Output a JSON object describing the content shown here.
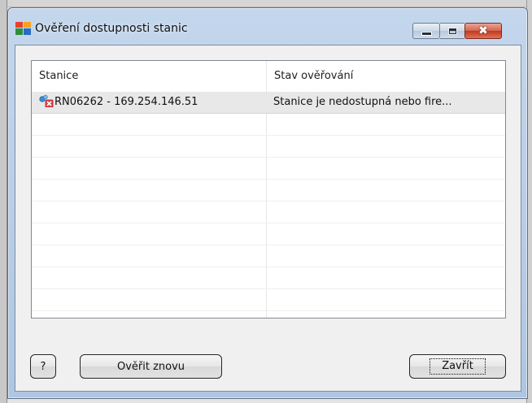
{
  "window": {
    "title": "Ověření dostupnosti stanic",
    "app_icon": "avg-logo-icon",
    "controls": {
      "minimize_icon": "minimize-icon",
      "maximize_icon": "maximize-icon",
      "close_glyph": "✖"
    }
  },
  "table": {
    "columns": [
      "Stanice",
      "Stav ověřování"
    ],
    "rows": [
      {
        "icon": "station-unreachable-icon",
        "station": "RN06262 - 169.254.146.51",
        "status": "Stanice je nedostupná nebo fire..."
      }
    ],
    "empty_row_count": 10
  },
  "buttons": {
    "help": "?",
    "retry": "Ověřit znovu",
    "close": "Zavřít"
  },
  "colors": {
    "title_bar": "#bcd2ea",
    "close_button": "#c94a30",
    "selected_row": "#e8e8e8"
  }
}
